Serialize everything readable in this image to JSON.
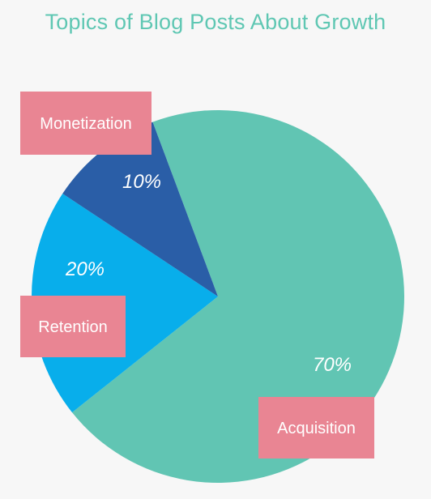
{
  "title": "Topics of Blog Posts About Growth",
  "colors": {
    "background": "#f7f7f7",
    "title": "#5fc7b3",
    "label_box": "#e98593",
    "label_text": "#ffffff"
  },
  "chart_data": {
    "type": "pie",
    "title": "Topics of Blog Posts About Growth",
    "slices": [
      {
        "label": "Acquisition",
        "value": 70,
        "display": "70%",
        "color": "#61c5b3"
      },
      {
        "label": "Retention",
        "value": 20,
        "display": "20%",
        "color": "#08aeeb"
      },
      {
        "label": "Monetization",
        "value": 10,
        "display": "10%",
        "color": "#2a5ea7"
      }
    ],
    "legend": "none",
    "data_labels": "inside slices"
  }
}
